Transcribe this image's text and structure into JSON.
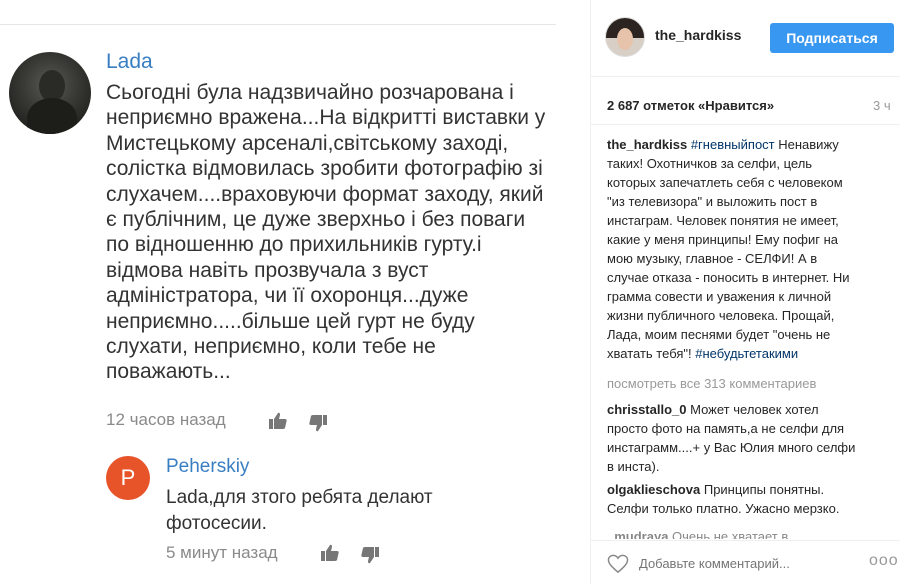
{
  "youtube": {
    "comment": {
      "author": "Lada",
      "text": "Сьогодні була надзвичайно розчарована і неприємно вражена...На відкритті виставки у Мистецькому арсеналі,світському заході, солістка відмовилась зробити фотографію зі слухачем....враховуючи формат заходу, який є публічним, це дуже зверхньо і без поваги по відношенню до прихильників гурту.і відмова навіть прозвучала з вуст адміністратора, чи її охоронця...дуже неприємно.....більше цей гурт не буду слухати, неприємно, коли тебе не поважають...",
      "time": "12 часов назад"
    },
    "reply": {
      "avatar_letter": "P",
      "author": "Peherskiy",
      "text": "Lada,для зтого ребята делают фотосесии.",
      "time": "5 минут назад"
    },
    "icons": {
      "like": "thumbs-up-icon",
      "dislike": "thumbs-down-icon"
    },
    "colors": {
      "author": "#3a7ec2",
      "reply_avatar": "#e8542a"
    }
  },
  "instagram": {
    "username": "the_hardkiss",
    "follow_label": "Подписаться",
    "likes": "2 687 отметок «Нравится»",
    "time_ago": "3 ч",
    "caption": {
      "user": "the_hardkiss",
      "tag1": "#гневныйпост",
      "text": "Ненавижу таких! Охотничков за селфи, цель которых запечатлеть себя с человеком \"из телевизора\" и выложить пост в инстаграм. Человек понятия не имеет, какие у меня принципы! Ему пофиг на мою музыку, главное - СЕЛФИ! А в случае отказа - поносить в интернет. Ни грамма совести и уважения к личной жизни публичного человека. Прощай, Лада, моим песнями будет \"очень не хватать тебя\"!",
      "tag2": "#небудьтетакими"
    },
    "view_all": "посмотреть все 313 комментариев",
    "comments": [
      {
        "user": "chrisstallo_0",
        "text": "Может человек хотел просто фото на память,а не селфи для инстаграмм....+ у Вас Юлия много селфи в инста)."
      },
      {
        "user": "olgaklieschova",
        "text": "Принципы понятны. Селфи только платно. Ужасно мерзко."
      },
      {
        "user": "_mudraya",
        "text": "Очень не хватает в"
      }
    ],
    "add_comment_placeholder": "Добавьте комментарий...",
    "more": "ooo",
    "colors": {
      "follow": "#3897f0",
      "hashtag": "#003569"
    }
  }
}
